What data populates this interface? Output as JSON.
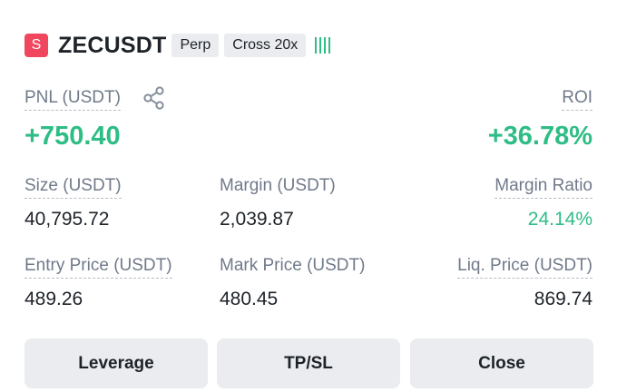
{
  "position": {
    "side_badge": "S",
    "symbol": "ZECUSDT",
    "contract_type": "Perp",
    "margin_mode": "Cross 20x",
    "side_color": "#f0475e",
    "accent_color": "#2ebd85"
  },
  "pnl": {
    "label": "PNL (USDT)",
    "value": "+750.40"
  },
  "roi": {
    "label": "ROI",
    "value": "+36.78%"
  },
  "size": {
    "label": "Size (USDT)",
    "value": "40,795.72"
  },
  "margin": {
    "label": "Margin (USDT)",
    "value": "2,039.87"
  },
  "margin_ratio": {
    "label": "Margin Ratio",
    "value": "24.14%"
  },
  "entry_price": {
    "label": "Entry Price (USDT)",
    "value": "489.26"
  },
  "mark_price": {
    "label": "Mark Price (USDT)",
    "value": "480.45"
  },
  "liq_price": {
    "label": "Liq. Price (USDT)",
    "value": "869.74"
  },
  "actions": {
    "leverage": "Leverage",
    "tpsl": "TP/SL",
    "close": "Close"
  },
  "icons": {
    "share": "share-icon",
    "signal": "signal-bars-icon"
  }
}
